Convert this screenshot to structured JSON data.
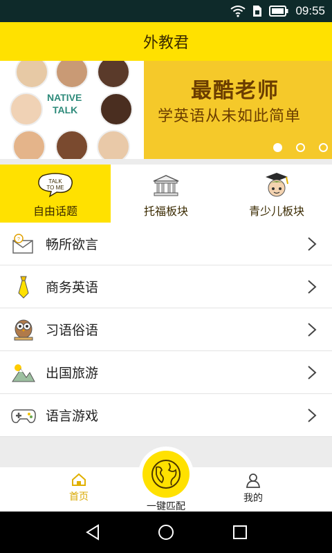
{
  "status": {
    "time": "09:55"
  },
  "header": {
    "title": "外教君"
  },
  "banner": {
    "title": "最酷老师",
    "subtitle": "学英语从未如此简单",
    "badge_line1": "NATIVE",
    "badge_line2": "TALK",
    "speech_line1": "TALK",
    "speech_line2": "TO ME"
  },
  "tabs": [
    {
      "label": "自由话题"
    },
    {
      "label": "托福板块"
    },
    {
      "label": "青少儿板块"
    }
  ],
  "list": [
    {
      "label": "畅所欲言",
      "icon": "mail-chat-icon"
    },
    {
      "label": "商务英语",
      "icon": "tie-icon"
    },
    {
      "label": "习语俗语",
      "icon": "owl-icon"
    },
    {
      "label": "出国旅游",
      "icon": "mountain-icon"
    },
    {
      "label": "语言游戏",
      "icon": "gamepad-icon"
    }
  ],
  "bottom_nav": {
    "home": "首页",
    "match": "一键匹配",
    "mine": "我的"
  },
  "colors": {
    "accent": "#ffe100",
    "active_text": "#d9a800"
  }
}
